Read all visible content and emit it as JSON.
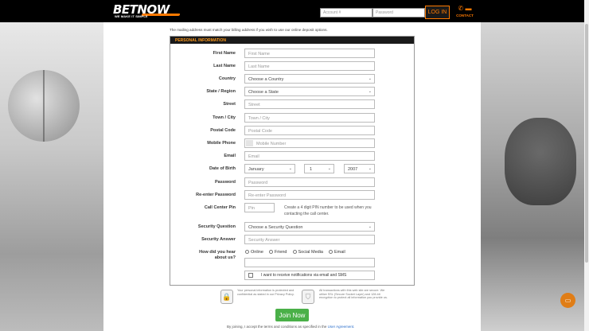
{
  "header": {
    "brand": "BETNOW",
    "tagline": "WE MAKE IT SIMPLE",
    "account_placeholder": "Account #",
    "password_placeholder": "Password",
    "login_label": "LOG IN",
    "contact_label": "CONTACT",
    "contact_icons": [
      "phone-icon",
      "chat-icon"
    ]
  },
  "notice": "The mailing address must match your billing address if you wish to use our online deposit options.",
  "form": {
    "section_title": "PERSONAL INFORMATION",
    "fields": {
      "first_name": {
        "label": "First Name",
        "placeholder": "First Name"
      },
      "last_name": {
        "label": "Last Name",
        "placeholder": "Last Name"
      },
      "country": {
        "label": "Country",
        "value": "Choose a Country"
      },
      "state": {
        "label": "State / Region",
        "value": "Choose a State"
      },
      "street": {
        "label": "Street",
        "placeholder": "Street"
      },
      "town": {
        "label": "Town / City",
        "placeholder": "Town / City"
      },
      "postal": {
        "label": "Postal Code",
        "placeholder": "Postal Code"
      },
      "mobile": {
        "label": "Mobile Phone",
        "placeholder": "Mobile Number"
      },
      "email": {
        "label": "Email",
        "placeholder": "Email"
      },
      "dob": {
        "label": "Date of Birth",
        "month": "January",
        "day": "1",
        "year": "2007"
      },
      "password": {
        "label": "Password",
        "placeholder": "Password"
      },
      "password2": {
        "label": "Re-enter Password",
        "placeholder": "Re-enter Password"
      },
      "pin": {
        "label": "Call Center Pin",
        "placeholder": "Pin",
        "help": "Create a 4 digit PIN number to be used when you contacting the call center."
      },
      "security_q": {
        "label": "Security Question",
        "value": "Choose a Security Question"
      },
      "security_a": {
        "label": "Security Answer",
        "placeholder": "Security Answer"
      },
      "hear": {
        "label_line1": "How did you hear",
        "label_line2": "about us?",
        "options": [
          "Online",
          "Friend",
          "Social Media",
          "Email"
        ]
      }
    },
    "notifications_label": "I want to receive notifications via email and SMS"
  },
  "secure_notes": {
    "privacy": "Your personal information is protected and confidential as stated in our Privacy Policy.",
    "ssl": "All transactions with this web site are secure. We utilize SSL (Secure Socket Layer) and 128-bit encryption to protect all information you provide us."
  },
  "join_label": "Join Now",
  "terms": {
    "text": "By joining, I accept the terms and conditions as specified in the",
    "link": "User Agreement."
  },
  "colors": {
    "accent": "#ff7a00",
    "join_green": "#4ab048",
    "header_bg": "#000000",
    "chat_button": "#e07d16"
  }
}
